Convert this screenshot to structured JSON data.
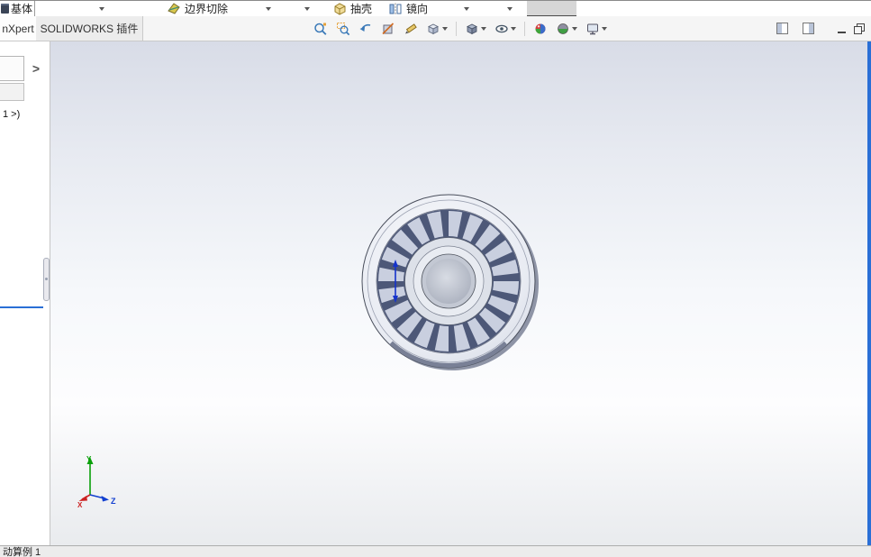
{
  "command_toolbar": {
    "base": "基体",
    "boundary_cut": "边界切除",
    "shell": "抽壳",
    "mirror": "镜向"
  },
  "tab_bar": {
    "dimxpert_tab": "nXpert",
    "addins_tab": "SOLIDWORKS 插件"
  },
  "feature_panel": {
    "expand_arrow": ">",
    "tree_item": "1 >)"
  },
  "view_toolbar": {
    "icons": [
      "zoom-to-fit",
      "zoom-to-area",
      "previous-view",
      "section-view",
      "3d-drawing-view",
      "view-orientation",
      "display-style",
      "hide-show-items",
      "edit-appearance",
      "apply-scene",
      "view-settings"
    ]
  },
  "triad": {
    "x_label": "X",
    "y_label": "Y",
    "z_label": "Z"
  },
  "status_bar": {
    "motion_study_tab": "动算例 1"
  },
  "colors": {
    "accent_blue": "#2a6fd6",
    "axis_x": "#cc2222",
    "axis_y": "#0aa00a",
    "axis_z": "#1240d0",
    "blade_dark": "#4d5878",
    "viewport_top": "#d8dce7",
    "viewport_bottom": "#e9ebee"
  }
}
